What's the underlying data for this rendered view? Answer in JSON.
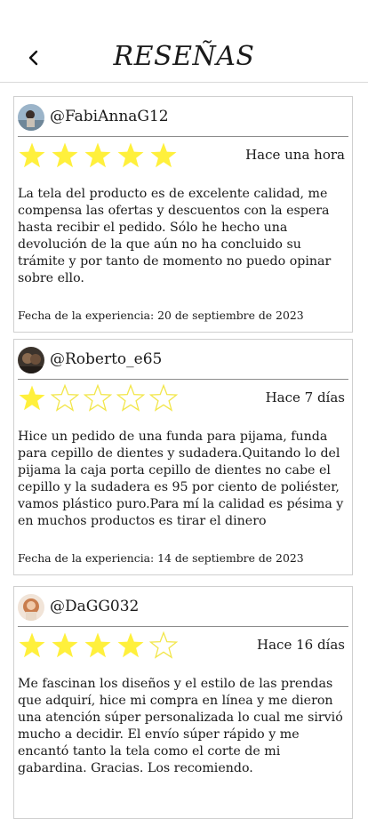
{
  "header": {
    "title": "RESEÑAS"
  },
  "reviews": [
    {
      "username": "@FabiAnnaG12",
      "rating": 5,
      "time": "Hace una hora",
      "text": "La tela del producto es de excelente calidad, me compensa las ofertas y descuentos con la espera hasta recibir el pedido. Sólo he hecho una devolución de la que aún no ha concluido su trámite y por tanto de momento no puedo opinar sobre ello.",
      "date": "Fecha de la experiencia: 20 de septiembre de 2023"
    },
    {
      "username": "@Roberto_e65",
      "rating": 1,
      "time": "Hace 7 días",
      "text": "Hice un pedido de una funda para pijama, funda para cepillo de dientes y sudadera.Quitando lo del pijama la caja porta cepillo de dientes no cabe el cepillo y la sudadera es 95 por ciento de poliéster, vamos plástico puro.Para mí la calidad es pésima y en muchos productos es tirar el dinero",
      "date": "Fecha de la experiencia: 14 de septiembre de 2023"
    },
    {
      "username": "@DaGG032",
      "rating": 4,
      "time": "Hace 16 días",
      "text": "Me fascinan los diseños y el estilo de las prendas que adquirí, hice mi compra en línea y me dieron una atención súper personalizada lo cual me sirvió mucho a decidir. El envío súper rápido y me encantó tanto la tela como el corte de mi gabardina. Gracias. Los recomiendo.",
      "date": ""
    }
  ],
  "colors": {
    "star": "#fff03c",
    "star_outline": "#f2e64a",
    "divider": "#8c8c8c"
  }
}
